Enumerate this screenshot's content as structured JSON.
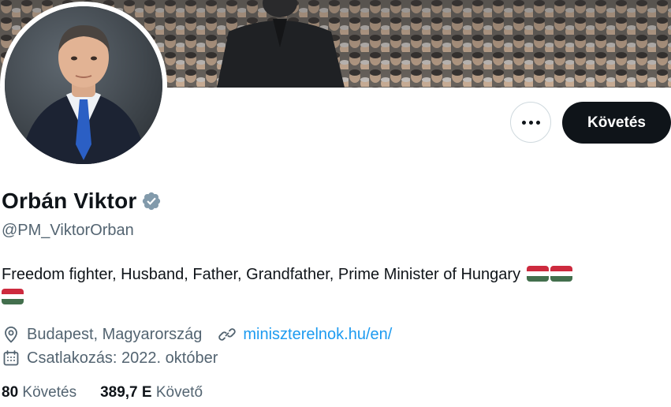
{
  "profile": {
    "name": "Orbán Viktor",
    "handle": "@PM_ViktorOrban",
    "bio": "Freedom fighter, Husband, Father, Grandfather, Prime Minister of Hungary",
    "bio_flags": [
      "hungary-flag",
      "hungary-flag",
      "hungary-flag"
    ],
    "location": "Budapest, Magyarország",
    "website": "miniszterelnok.hu/en/",
    "joined": "Csatlakozás: 2022. október"
  },
  "actions": {
    "follow_label": "Követés",
    "more_icon": "more-horizontal-icon"
  },
  "stats": {
    "following_count": "80",
    "following_label": "Követés",
    "followers_count": "389,7 E",
    "followers_label": "Követő"
  },
  "colors": {
    "link": "#1d9bf0",
    "verified": "#829aab",
    "secondary_text": "#536471",
    "primary_text": "#0f1419",
    "follow_button_bg": "#0f1419",
    "flag_red": "#cd2a3e",
    "flag_white": "#ffffff",
    "flag_green": "#436f4d"
  }
}
